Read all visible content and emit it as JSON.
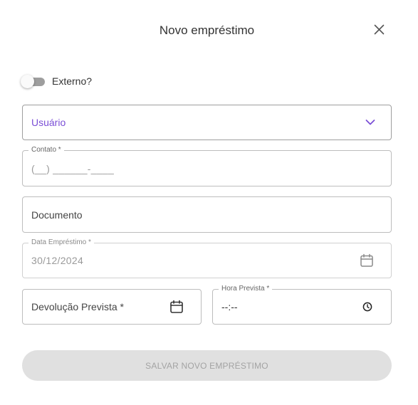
{
  "modal": {
    "title": "Novo empréstimo"
  },
  "toggle": {
    "label": "Externo?",
    "checked": false
  },
  "fields": {
    "usuario": {
      "value": "Usuário"
    },
    "contato": {
      "label": "Contato *",
      "placeholder": "(__) ______-____"
    },
    "documento": {
      "value": "Documento"
    },
    "data_emprestimo": {
      "label": "Data Empréstimo *",
      "value": "30/12/2024"
    },
    "devolucao_prevista": {
      "value": "Devolução Prevista *"
    },
    "hora_prevista": {
      "label": "Hora Prevista *",
      "value": "--:--"
    }
  },
  "actions": {
    "save_label": "SALVAR NOVO EMPRÉSTIMO"
  },
  "colors": {
    "accent": "#7b4fd6",
    "button_disabled_bg": "#e0e0e0",
    "button_disabled_text": "#a3a3a3"
  },
  "icons": {
    "close": "close-icon",
    "dropdown": "chevron-down-icon",
    "calendar": "calendar-icon",
    "clock": "clock-icon"
  }
}
